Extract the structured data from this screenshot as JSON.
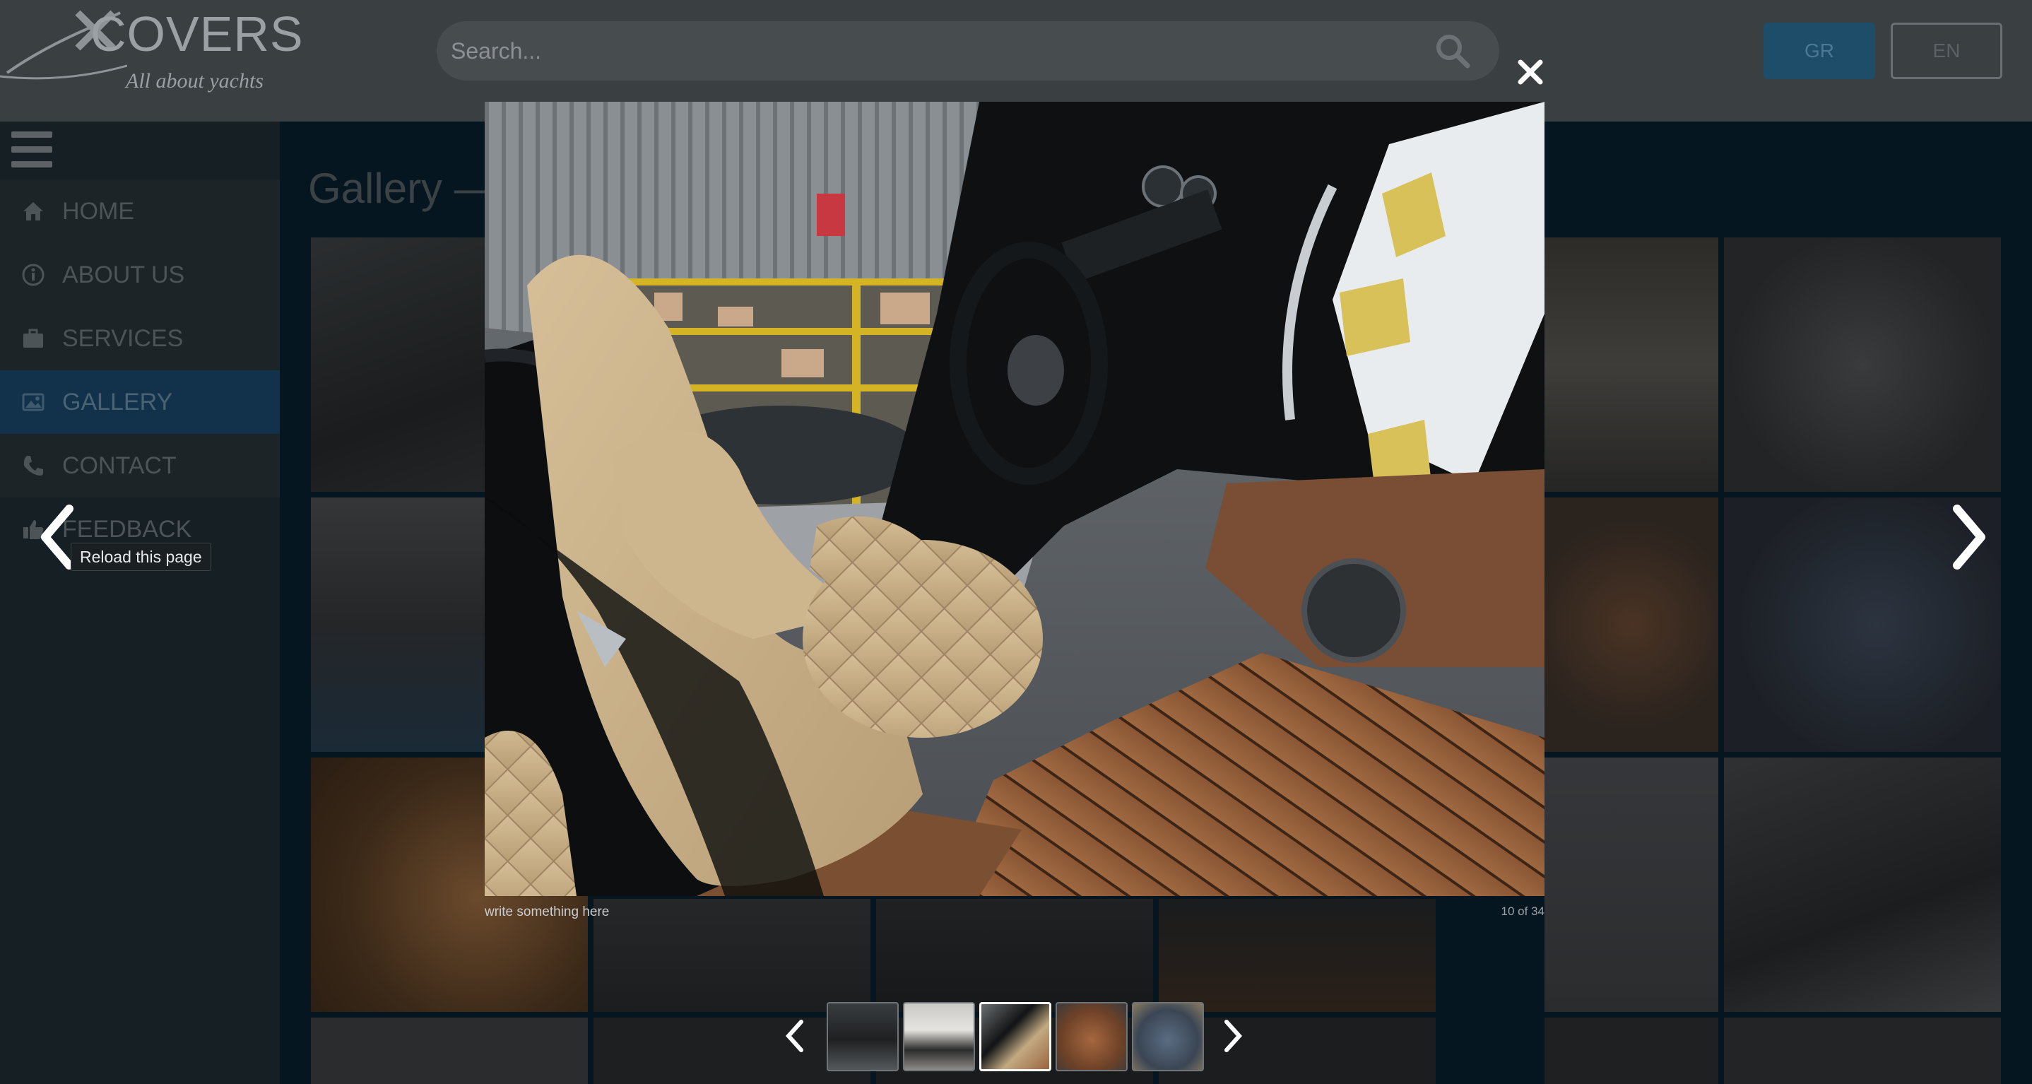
{
  "header": {
    "logo_text": "COVERS",
    "logo_tagline": "All about yachts",
    "search_placeholder": "Search...",
    "lang_gr": "GR",
    "lang_en": "EN"
  },
  "sidebar": {
    "items": [
      {
        "label": "HOME",
        "icon": "home-icon"
      },
      {
        "label": "ABOUT US",
        "icon": "info-icon"
      },
      {
        "label": "SERVICES",
        "icon": "briefcase-icon"
      },
      {
        "label": "GALLERY",
        "icon": "image-icon"
      },
      {
        "label": "CONTACT",
        "icon": "phone-icon"
      },
      {
        "label": "FEEDBACK",
        "icon": "thumbs-up-icon"
      }
    ],
    "active_index": 3
  },
  "main": {
    "page_title": "Gallery —"
  },
  "lightbox": {
    "caption": "write something here",
    "counter": "10 of 34",
    "tooltip": "Reload this page",
    "active_thumb": 2
  },
  "colors": {
    "accent": "#12314a",
    "overlay": "#000000"
  }
}
